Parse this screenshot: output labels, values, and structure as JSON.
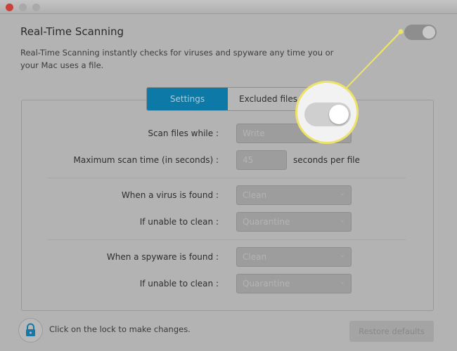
{
  "window": {
    "controls": [
      "close",
      "minimize",
      "zoom"
    ]
  },
  "header": {
    "title": "Real-Time Scanning",
    "description": "Real-Time Scanning instantly checks for viruses and spyware any time you or your Mac uses a file.",
    "toggle_on": true
  },
  "tabs": [
    {
      "label": "Settings",
      "active": true
    },
    {
      "label": "Excluded files",
      "active": false
    }
  ],
  "settings": {
    "scan_files_while": {
      "label": "Scan files while :",
      "value": "Write"
    },
    "max_scan_time": {
      "label": "Maximum scan time (in seconds) :",
      "value": "45",
      "unit": "seconds per file"
    },
    "virus_found": {
      "label": "When a virus is found :",
      "value": "Clean"
    },
    "virus_unable": {
      "label": "If unable to clean :",
      "value": "Quarantine"
    },
    "spyware_found": {
      "label": "When a spyware is found :",
      "value": "Clean"
    },
    "spyware_unable": {
      "label": "If unable to clean :",
      "value": "Quarantine"
    }
  },
  "footer": {
    "lock_note": "Click on the lock to make changes.",
    "restore_label": "Restore defaults"
  },
  "colors": {
    "accent": "#0c79a7",
    "highlight": "#eee36a",
    "close": "#d9443f"
  }
}
